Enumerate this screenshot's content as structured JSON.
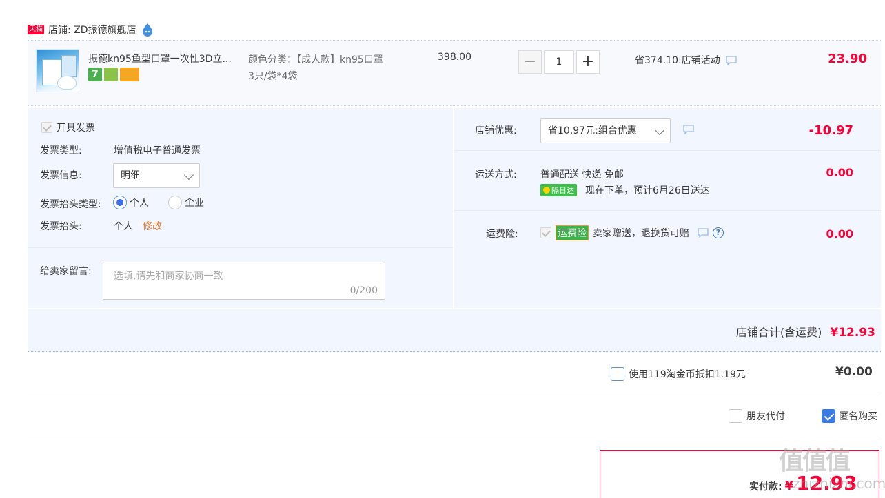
{
  "store": {
    "badge": "天猫",
    "name": "店铺: ZD振德旗舰店"
  },
  "item": {
    "title": "振德kn95鱼型口罩一次性3D立...",
    "sku_line1": "颜色分类：【成人款】kn95口罩",
    "sku_line2": "3只/袋*4袋",
    "unit_price": "398.00",
    "quantity": "1",
    "minus": "−",
    "plus": "+",
    "discount": "省374.10:店铺活动",
    "total": "23.90",
    "service_icon_7": "7"
  },
  "invoice": {
    "checkbox_label": "开具发票",
    "type_label": "发票类型:",
    "type_value": "增值税电子普通发票",
    "info_label": "发票信息:",
    "info_value": "明细",
    "header_type_label": "发票抬头类型:",
    "header_type_personal": "个人",
    "header_type_company": "企业",
    "header_label": "发票抬头:",
    "header_value": "个人",
    "header_edit": "修改"
  },
  "memo": {
    "label": "给卖家留言:",
    "placeholder": "选填,请先和商家协商一致",
    "counter": "0/200"
  },
  "shop_discount": {
    "label": "店铺优惠:",
    "value": "省10.97元:组合优惠",
    "amount": "-10.97"
  },
  "shipping": {
    "label": "运送方式:",
    "method": "普通配送 快递 免邮",
    "badge": "隔日达",
    "eta": "现在下单，预计6月26日送达",
    "amount": "0.00"
  },
  "insurance": {
    "label": "运费险:",
    "badge": "运费险",
    "text": "卖家赠送，退换货可赔",
    "help": "?",
    "amount": "0.00"
  },
  "subtotal": {
    "label": "店铺合计(含运费)",
    "amount": "¥12.93"
  },
  "coins": {
    "label": "使用119淘金币抵扣1.19元",
    "amount": "¥0.00"
  },
  "options": {
    "friend_pay": "朋友代付",
    "anonymous": "匿名购买"
  },
  "payment": {
    "label": "实付款:",
    "currency": "¥",
    "amount": "12.93"
  },
  "watermark": {
    "top": "值值值",
    "bottom": "zhizhizhi.com"
  },
  "colors": {
    "accent_red": "#ff0036",
    "panel_blue": "#f2f7ff",
    "checkbox_blue": "#3d7ae0"
  }
}
